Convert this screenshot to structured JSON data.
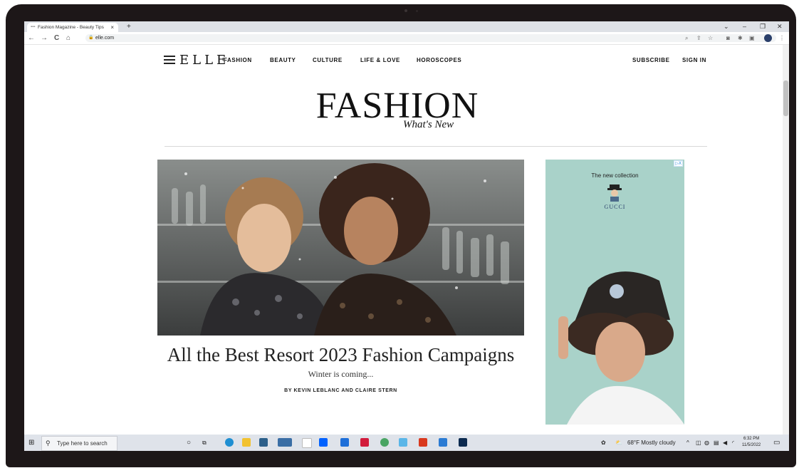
{
  "browser": {
    "tab_title": "Fashion Magazine - Beauty Tips",
    "tab_close": "×",
    "new_tab": "+",
    "url": "elle.com",
    "window_controls": [
      "⌄",
      "–",
      "❐",
      "✕"
    ],
    "nav_buttons": [
      "←",
      "→",
      "C",
      "⌂"
    ]
  },
  "site": {
    "logo": "ELLE",
    "nav": [
      "FASHION",
      "BEAUTY",
      "CULTURE",
      "LIFE & LOVE",
      "HOROSCOPES"
    ],
    "subscribe": "SUBSCRIBE",
    "sign_in": "SIGN IN"
  },
  "section": {
    "title": "FASHION",
    "subtitle": "What's New"
  },
  "article": {
    "headline": "All the Best Resort 2023 Fashion Campaigns",
    "dek": "Winter is coming...",
    "byline": "BY KEVIN LEBLANC AND CLAIRE STERN"
  },
  "ad": {
    "badge": "▷X",
    "text": "The new collection",
    "brand": "GUCCI"
  },
  "taskbar": {
    "search_placeholder": "Type here to search",
    "weather": "68°F  Mostly cloudy",
    "time": "6:32 PM",
    "date": "11/5/2022"
  },
  "colors": {
    "ad_bg": "#a9d2c9",
    "taskbar_bg": "#dfe3ea",
    "bezel": "#1d1718"
  }
}
